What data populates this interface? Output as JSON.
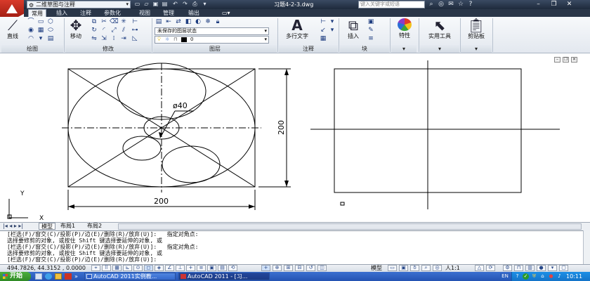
{
  "titlebar": {
    "workspace": "二维草图与注释",
    "document_title": "习题4-2-3.dwg",
    "search_placeholder": "键入关键字或短语"
  },
  "tabs": [
    "常用",
    "插入",
    "注释",
    "参数化",
    "视图",
    "管理",
    "输出"
  ],
  "active_tab": "常用",
  "ribbon": {
    "line_label": "直线",
    "move_label": "移动",
    "layer_state": "未保存的图层状态",
    "layer_name": "0",
    "mtext_label": "多行文字",
    "insert_label": "插入",
    "properties_label": "特性",
    "utilities_label": "实用工具",
    "clipboard_label": "剪贴板",
    "panels": {
      "draw": "绘图",
      "modify": "修改",
      "layers": "图层",
      "annotation": "注释",
      "block": "块"
    }
  },
  "drawing": {
    "dim_diameter": "ø40",
    "dim_vertical": "200",
    "dim_horizontal": "200",
    "ucs_x": "X",
    "ucs_y": "Y"
  },
  "layout_tabs": [
    "模型",
    "布局1",
    "布局2"
  ],
  "command_lines": [
    "[栏选(F)/窗交(C)/投影(P)/边(E)/删除(R)/放弃(U)]:   指定对角点:",
    "选择要修剪的对象, 或按住 Shift 键选择要延伸的对象, 或",
    "[栏选(F)/窗交(C)/投影(P)/边(E)/删除(R)/放弃(U)]:   指定对角点:",
    "选择要修剪的对象, 或按住 Shift 键选择要延伸的对象, 或",
    "[栏选(F)/窗交(C)/投影(P)/边(E)/删除(R)/放弃(U)]:"
  ],
  "status": {
    "coordinates": "494.7826, 44.3152 , 0.0000",
    "model_label": "模型",
    "annotation_scale": "人1:1"
  },
  "taskbar": {
    "start_label": "开始",
    "task1": "AutoCAD 2011实例教...",
    "task2": "AutoCAD 2011 - [习...",
    "lang": "EN",
    "clock": "10:11"
  }
}
